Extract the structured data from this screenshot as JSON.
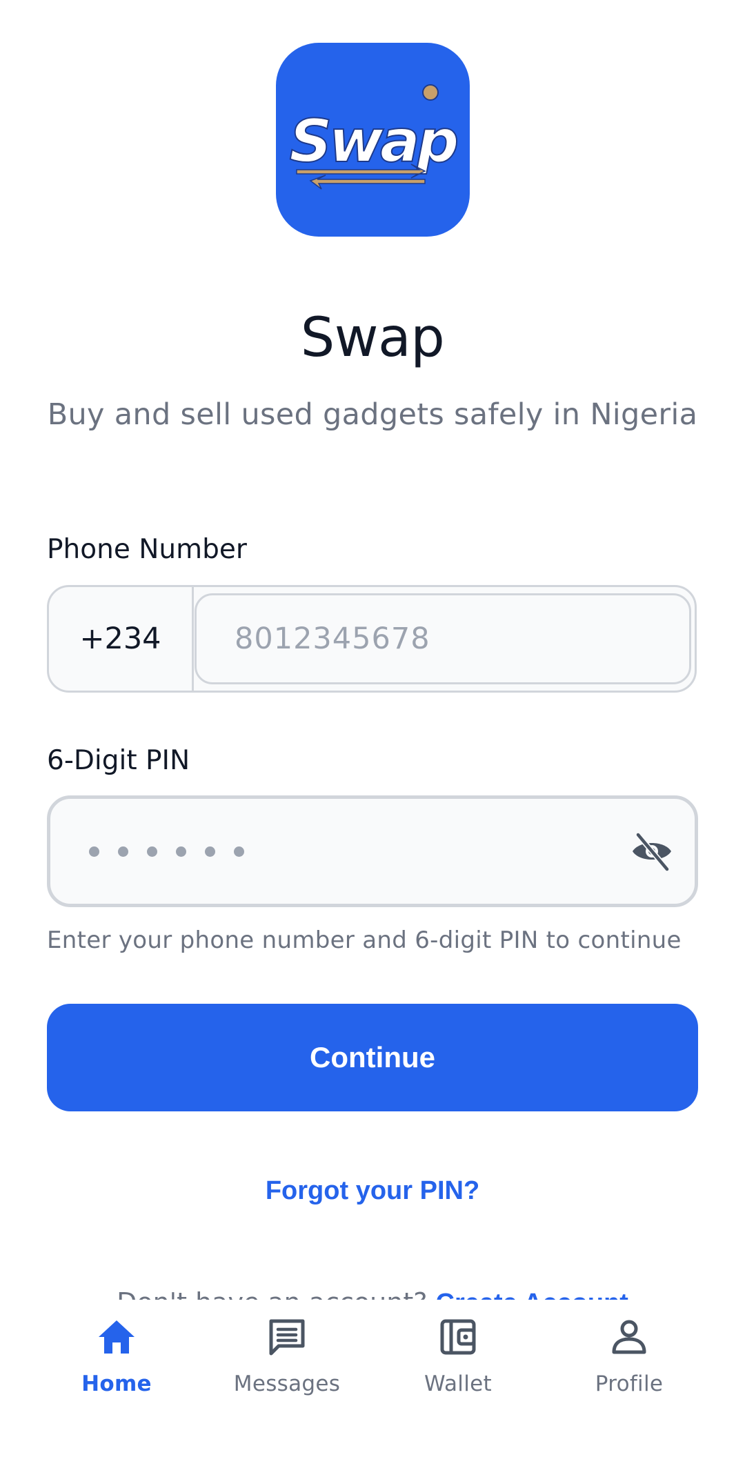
{
  "app": {
    "logo_text": "Swap",
    "title": "Swap",
    "subtitle": "Buy and sell used gadgets safely in Nigeria"
  },
  "form": {
    "phone_label": "Phone Number",
    "country_code": "+234",
    "phone_placeholder": "8012345678",
    "phone_value": "",
    "pin_label": "6-Digit PIN",
    "pin_length": 6,
    "helper_text": "Enter your phone number and 6-digit PIN to continue",
    "continue_label": "Continue",
    "forgot_pin_label": "Forgot your PIN?",
    "signup_prompt": "Don't have an account?",
    "create_account_label": "Create Account"
  },
  "nav": {
    "items": [
      {
        "label": "Home",
        "icon": "home-icon",
        "active": true
      },
      {
        "label": "Messages",
        "icon": "messages-icon",
        "active": false
      },
      {
        "label": "Wallet",
        "icon": "wallet-icon",
        "active": false
      },
      {
        "label": "Profile",
        "icon": "profile-icon",
        "active": false
      }
    ]
  },
  "colors": {
    "accent": "#2563eb",
    "logo_gold": "#c8a06a",
    "text_primary": "#111827",
    "text_secondary": "#6b7280",
    "placeholder": "#9ca3af",
    "border": "#d1d5db",
    "field_bg": "#f9fafb"
  }
}
